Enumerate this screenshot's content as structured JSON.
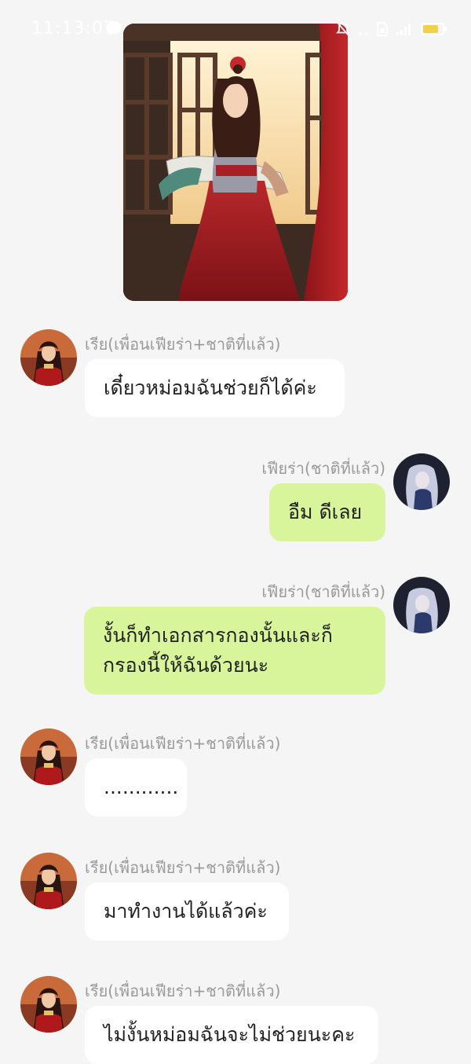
{
  "status_bar": {
    "time": "11:13:07",
    "battery_level": 0.8
  },
  "chat": {
    "shared_image": {
      "description": "anime illustration"
    },
    "messages": [
      {
        "side": "incoming",
        "sender": "เรีย(เพื่อนเฟียร่า+ชาติที่แล้ว)",
        "text": "เดี๋ยวหม่อมฉันช่วยก็ได้ค่ะ"
      },
      {
        "side": "outgoing",
        "sender": "เฟียร่า(ชาติที่แล้ว)",
        "text": "อืม ดีเลย"
      },
      {
        "side": "outgoing",
        "sender": "เฟียร่า(ชาติที่แล้ว)",
        "text": "งั้นก็ทำเอกสารกองนั้นและก็\nกรองนี้ให้ฉันด้วยนะ"
      },
      {
        "side": "incoming",
        "sender": "เรีย(เพื่อนเฟียร่า+ชาติที่แล้ว)",
        "text": "............"
      },
      {
        "side": "incoming",
        "sender": "เรีย(เพื่อนเฟียร่า+ชาติที่แล้ว)",
        "text": "มาทำงานได้แล้วค่ะ"
      },
      {
        "side": "incoming",
        "sender": "เรีย(เพื่อนเฟียร่า+ชาติที่แล้ว)",
        "text": "ไม่งั้นหม่อมฉันจะไม่ช่วยนะคะ"
      }
    ]
  },
  "colors": {
    "background": "#f5f5f5",
    "incoming_bubble": "#ffffff",
    "outgoing_bubble": "#d8f59c",
    "sender_text": "#9a9a9a"
  }
}
